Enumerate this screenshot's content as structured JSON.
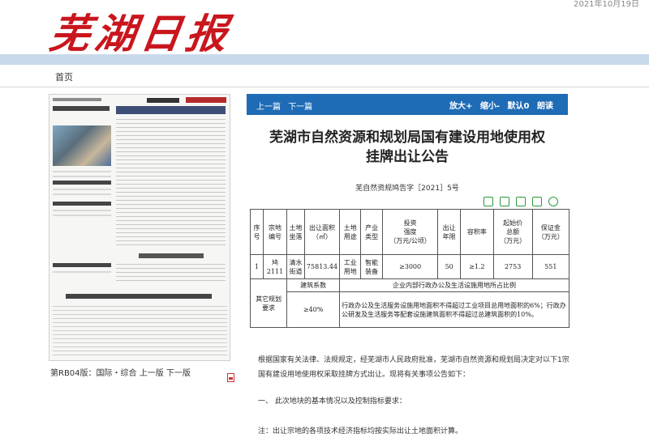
{
  "header": {
    "logo": "芜湖日报",
    "date": "2021年10月19日"
  },
  "nav": {
    "home": "首页"
  },
  "sidebar": {
    "page_caption": "第RB04版：国际・综合",
    "prev": "上一版",
    "next": "下一版"
  },
  "toolbar": {
    "prev_article": "上一篇",
    "next_article": "下一篇",
    "zoom_in": "放大+",
    "zoom_out": "缩小-",
    "default": "默认0",
    "read": "朗读"
  },
  "article": {
    "title_line1": "芜湖市自然资源和规划局国有建设用地使用权",
    "title_line2": "挂牌出让公告",
    "doc_number": "芜自然资规鸠告字［2021］5号",
    "table": {
      "headers": [
        "序号",
        "宗地\n编号",
        "土地坐落",
        "出让面积\n（㎡）",
        "土地\n用途",
        "产业\n类型",
        "投资\n强度\n（万元/公顷）",
        "出让\n年限",
        "容积率",
        "起始价\n总额\n（万元）",
        "保证金\n（万元）"
      ],
      "row": [
        "1",
        "鸠 2111",
        "清水街道",
        "75813.44",
        "工业\n用地",
        "智能\n装备",
        "≥3000",
        "50",
        "≥1.2",
        "2753",
        "551"
      ],
      "other_label": "其它规划\n要求",
      "sub_h1": "建筑系数",
      "sub_h2": "企业内部行政办公及生活设施用地所占比例",
      "sub_v1": "≥40%",
      "sub_v2": "行政办公及生活服务设施用地面积不得超过工业项目总用地面积的6%；行政办公研发及生活服务等配套设施建筑面积不得超过总建筑面积的10%。"
    },
    "para1": "根据国家有关法律、法规规定，经芜湖市人民政府批准，芜湖市自然资源和规划局决定对以下1宗国有建设用地使用权采取挂牌方式出让。现将有关事项公告如下：",
    "section1": "一、 此次地块的基本情况以及控制指标要求：",
    "note": "注：出让宗地的各项技术经济指标均按实际出让土地面积计算。"
  }
}
